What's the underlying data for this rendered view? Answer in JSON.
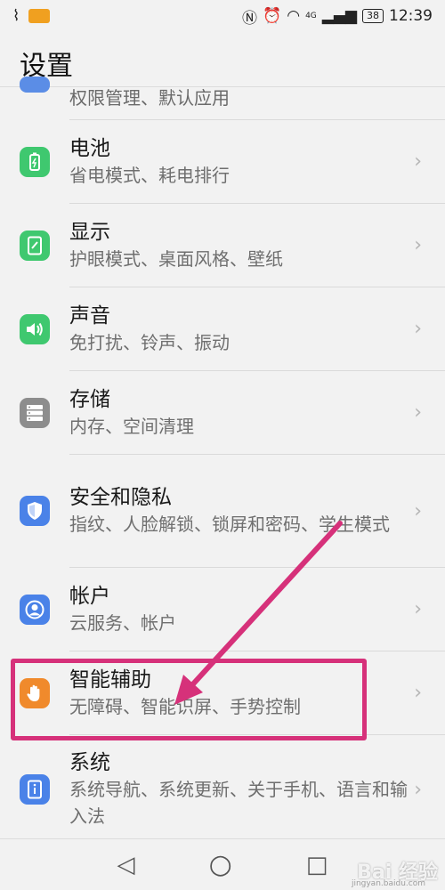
{
  "status_bar": {
    "network": "4G",
    "battery": "38",
    "time": "12:39"
  },
  "header": {
    "title": "设置"
  },
  "partial_item": {
    "desc": "权限管理、默认应用"
  },
  "items": [
    {
      "label": "电池",
      "desc": "省电模式、耗电排行",
      "icon": "battery-icon",
      "color": "#3fc86f"
    },
    {
      "label": "显示",
      "desc": "护眼模式、桌面风格、壁纸",
      "icon": "display-icon",
      "color": "#3fc86f"
    },
    {
      "label": "声音",
      "desc": "免打扰、铃声、振动",
      "icon": "speaker-icon",
      "color": "#3fc86f"
    },
    {
      "label": "存储",
      "desc": "内存、空间清理",
      "icon": "storage-icon",
      "color": "#8d8d8d"
    },
    {
      "label": "安全和隐私",
      "desc": "指纹、人脸解锁、锁屏和密码、学生模式",
      "icon": "shield-icon",
      "color": "#4a82e8"
    },
    {
      "label": "帐户",
      "desc": "云服务、帐户",
      "icon": "account-icon",
      "color": "#4a82e8"
    },
    {
      "label": "智能辅助",
      "desc": "无障碍、智能识屏、手势控制",
      "icon": "hand-icon",
      "color": "#f08a2c"
    },
    {
      "label": "系统",
      "desc": "系统导航、系统更新、关于手机、语言和输入法",
      "icon": "info-icon",
      "color": "#4a82e8"
    }
  ],
  "nav": {
    "back": "◁",
    "home": "○",
    "recent": "□"
  },
  "annotation_color": "#d6317a",
  "watermark": {
    "text": "Bai 经验",
    "sub": "jingyan.baidu.com"
  }
}
